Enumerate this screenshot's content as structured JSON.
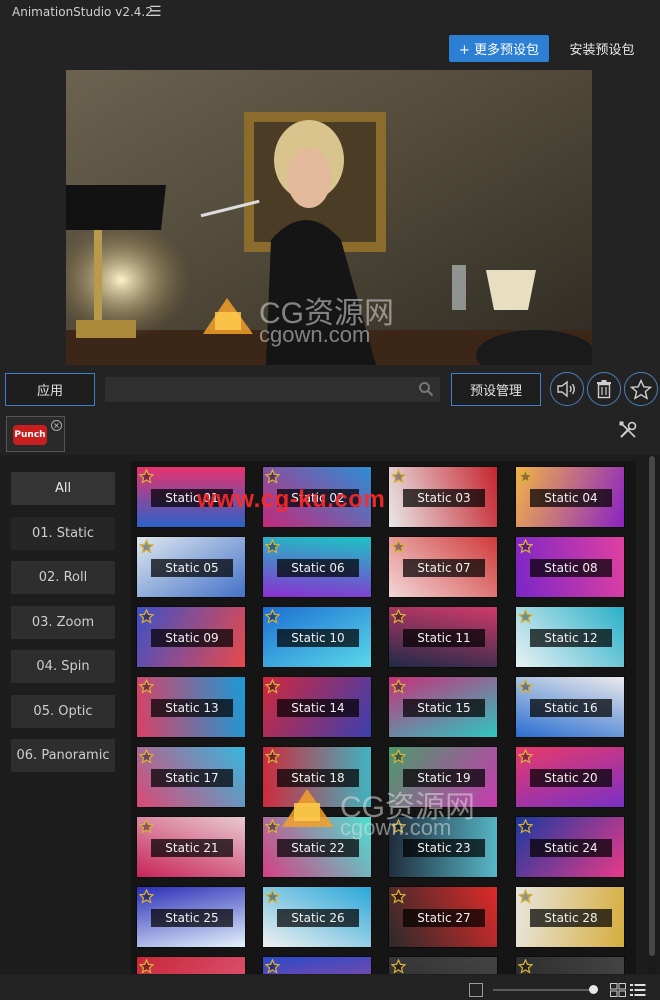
{
  "app": {
    "title": "AnimationStudio v2.4.2"
  },
  "header": {
    "more_presets_label": "+ 更多预设包",
    "install_label": "安装预设包"
  },
  "watermarks": {
    "top": "www.cg-ku.com",
    "cg_text": "CG资源网",
    "cgown": "cgown.com"
  },
  "toolbar": {
    "apply_label": "应用",
    "search_placeholder": "",
    "manage_label": "预设管理"
  },
  "tabs": [
    {
      "label": "Punch"
    }
  ],
  "categories": [
    "All",
    "01. Static",
    "02. Roll",
    "03. Zoom",
    "04. Spin",
    "05. Optic",
    "06. Panoramic"
  ],
  "presets": [
    "Static 01",
    "Static 02",
    "Static 03",
    "Static 04",
    "Static 05",
    "Static 06",
    "Static 07",
    "Static 08",
    "Static 09",
    "Static 10",
    "Static 11",
    "Static 12",
    "Static 13",
    "Static 14",
    "Static 15",
    "Static 16",
    "Static 17",
    "Static 18",
    "Static 19",
    "Static 20",
    "Static 21",
    "Static 22",
    "Static 23",
    "Static 24",
    "Static 25",
    "Static 26",
    "Static 27",
    "Static 28",
    "",
    "",
    "",
    ""
  ],
  "colors": {
    "accent": "#2d7fd3",
    "outline": "#3e7fc6",
    "punch": "#c81e1e"
  },
  "status": {
    "thumbnail_size": 0.97
  }
}
